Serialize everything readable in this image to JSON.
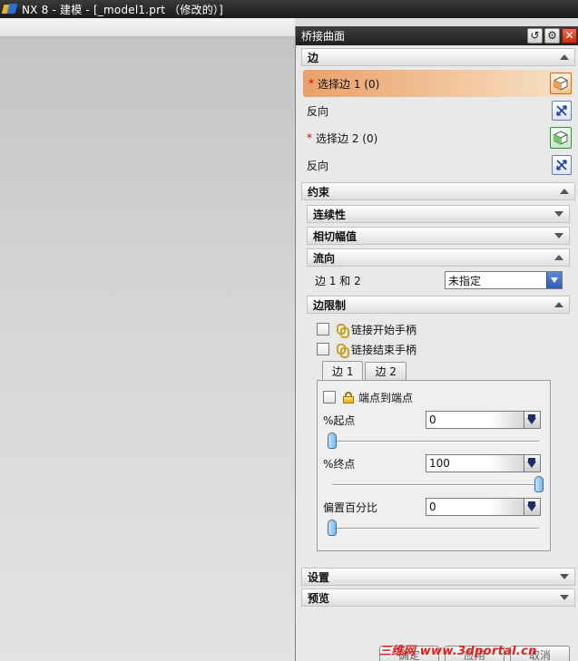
{
  "window": {
    "title": "NX 8 - 建模 - [_model1.prt （修改的）]"
  },
  "dialog": {
    "title": "桥接曲面",
    "header_buttons": [
      "reset-icon",
      "settings-icon",
      "close-icon"
    ],
    "sections": {
      "edge": {
        "header": "边",
        "select_edge_1": "选择边 1 (0)",
        "reverse_1": "反向",
        "select_edge_2": "选择边 2 (0)",
        "reverse_2": "反向"
      },
      "constraints": {
        "header": "约束",
        "continuity": "连续性",
        "tangent_magnitude": "相切幅值",
        "flow": {
          "header": "流向",
          "label": "边 1 和 2",
          "selected": "未指定"
        },
        "edge_limits": {
          "header": "边限制",
          "link_start_handle": "链接开始手柄",
          "link_end_handle": "链接结束手柄",
          "tabs": [
            "边 1",
            "边 2"
          ],
          "active_tab": "边 1",
          "endpoint_to_endpoint": "端点到端点",
          "start_label": "%起点",
          "start_value": "0",
          "end_label": "%终点",
          "end_value": "100",
          "offset_label": "偏置百分比",
          "offset_value": "0"
        }
      },
      "settings": {
        "header": "设置"
      },
      "preview": {
        "header": "预览"
      }
    },
    "footer": {
      "ok": "确定",
      "apply": "应用",
      "cancel": "取消"
    }
  },
  "watermark": {
    "prefix": "三维网",
    "url": "www.3dportal.cn"
  },
  "colors": {
    "title_bar": "#1f1f1f",
    "selection_highlight": "#e9a06a",
    "required_marker": "#d00000",
    "dropdown_arrow": "#2c5eb8",
    "watermark": "#e02020"
  },
  "sliders": {
    "start_percent": 0,
    "end_percent": 100,
    "offset_percent": 0
  }
}
